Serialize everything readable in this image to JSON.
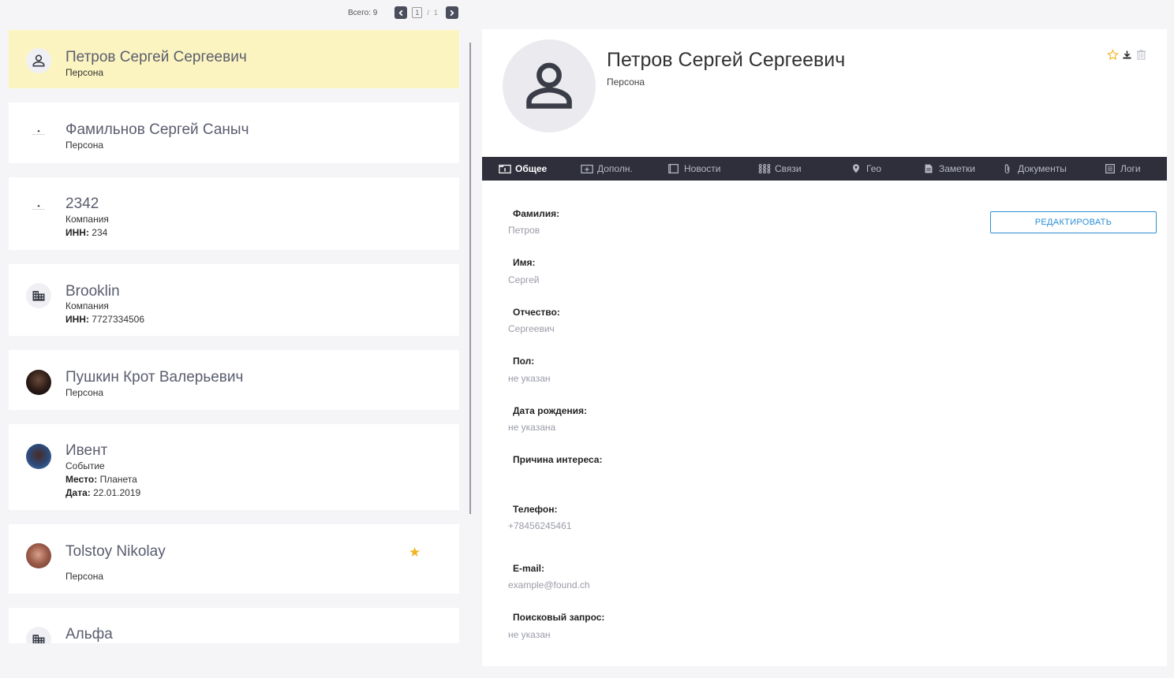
{
  "pager": {
    "total_label": "Всего: 9",
    "current_page": "1",
    "separator": "/",
    "total_pages": "1"
  },
  "list": [
    {
      "title": "Петров Сергей Сергеевич",
      "type": "Персона",
      "avatar": "person-icon"
    },
    {
      "title": "Фамильнов Сергей Саныч",
      "type": "Персона",
      "avatar": "small-photo"
    },
    {
      "title": "2342",
      "type": "Компания",
      "inn_label": "ИНН:",
      "inn_value": " 234",
      "avatar": "small-photo"
    },
    {
      "title": "Brooklin",
      "type": "Компания",
      "inn_label": "ИНН:",
      "inn_value": " 7727334506",
      "avatar": "building-icon"
    },
    {
      "title": "Пушкин Крот Валерьевич",
      "type": "Персона",
      "avatar": "photo"
    },
    {
      "title": "Ивент",
      "type": "Событие",
      "place_label": "Место:",
      "place_value": " Планета",
      "date_label": "Дата:",
      "date_value": " 22.01.2019",
      "avatar": "photo"
    },
    {
      "title": "Tolstoy Nikolay",
      "type": "Персона",
      "avatar": "photo",
      "starred": true
    },
    {
      "title": "Альфа",
      "avatar": "building-icon"
    }
  ],
  "detail": {
    "name": "Петров Сергей Сергеевич",
    "type": "Персона",
    "tabs": [
      {
        "label": "Общее",
        "icon": "info-card-icon",
        "active": true
      },
      {
        "label": "Дополн.",
        "icon": "add-card-icon"
      },
      {
        "label": "Новости",
        "icon": "news-icon"
      },
      {
        "label": "Связи",
        "icon": "network-icon"
      },
      {
        "label": "Гео",
        "icon": "pin-icon"
      },
      {
        "label": "Заметки",
        "icon": "note-icon"
      },
      {
        "label": "Документы",
        "icon": "paperclip-icon"
      },
      {
        "label": "Логи",
        "icon": "log-icon"
      }
    ],
    "edit_label": "РЕДАКТИРОВАТЬ",
    "fields": [
      {
        "label": "Фамилия:",
        "value": "Петров"
      },
      {
        "label": "Имя:",
        "value": "Сергей"
      },
      {
        "label": "Отчество:",
        "value": "Сергеевич"
      },
      {
        "label": "Пол:",
        "value": "не указан"
      },
      {
        "label": "Дата рождения:",
        "value": "не указана"
      },
      {
        "label": "Причина интереса:",
        "value": ""
      },
      {
        "label": "Телефон:",
        "value": "+78456245461"
      },
      {
        "label": "E-mail:",
        "value": "example@found.ch"
      },
      {
        "label": "Поисковый запрос:",
        "value": "не указан"
      }
    ]
  },
  "colors": {
    "selected_bg": "#fcf4c0",
    "tabbar_bg": "#2e2f3a",
    "accent": "#2b8fd6",
    "star": "#f0b424"
  }
}
